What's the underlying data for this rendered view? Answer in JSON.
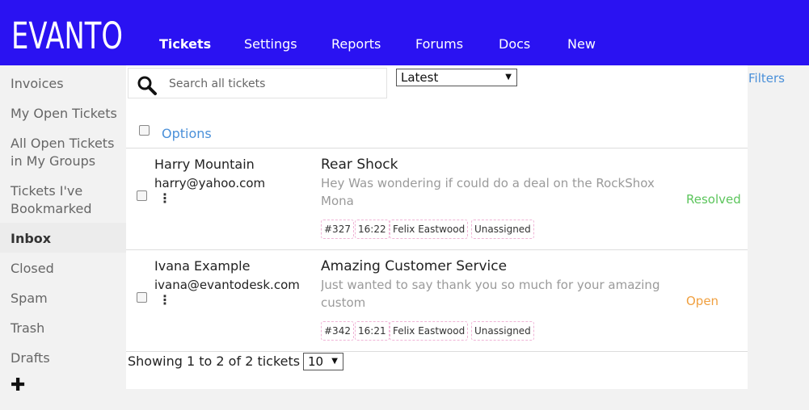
{
  "brand": {
    "logo_text": "EVANTO",
    "bar_color": "#2a12f2"
  },
  "nav": [
    {
      "label": "Tickets",
      "active": true
    },
    {
      "label": "Settings"
    },
    {
      "label": "Reports"
    },
    {
      "label": "Forums"
    },
    {
      "label": "Docs"
    },
    {
      "label": "New"
    }
  ],
  "sidebar": {
    "items": [
      {
        "label": "Invoices"
      },
      {
        "label": "My Open Tickets"
      },
      {
        "label": "All Open Tickets in My Groups"
      },
      {
        "label": "Tickets I've Bookmarked"
      },
      {
        "label": "Inbox",
        "active": true
      },
      {
        "label": "Closed"
      },
      {
        "label": "Spam"
      },
      {
        "label": "Trash"
      },
      {
        "label": "Drafts"
      }
    ],
    "add_icon": "plus-icon"
  },
  "toolbar": {
    "search_placeholder": "Search all tickets",
    "sort_value": "Latest",
    "filters_label": "Filters",
    "options_label": "Options"
  },
  "tickets": [
    {
      "customer_name": "Harry Mountain",
      "customer_email": "harry@yahoo.com",
      "subject": "Rear Shock",
      "preview": "Hey Was wondering if could do a deal on the RockShox Mona",
      "tags": [
        "#327",
        "16:22",
        "Felix Eastwood",
        "Unassigned"
      ],
      "status": "Resolved",
      "status_color": "#5cc55c"
    },
    {
      "customer_name": "Ivana Example",
      "customer_email": "ivana@evantodesk.com",
      "subject": "Amazing Customer Service",
      "preview": "Just wanted to say thank you so much for your amazing custom",
      "tags": [
        "#342",
        "16:21",
        "Felix Eastwood",
        "Unassigned"
      ],
      "status": "Open",
      "status_color": "#f0a040"
    }
  ],
  "footer": {
    "showing_text": "Showing 1 to 2 of 2 tickets",
    "current_page": "1",
    "page_size": "10"
  }
}
